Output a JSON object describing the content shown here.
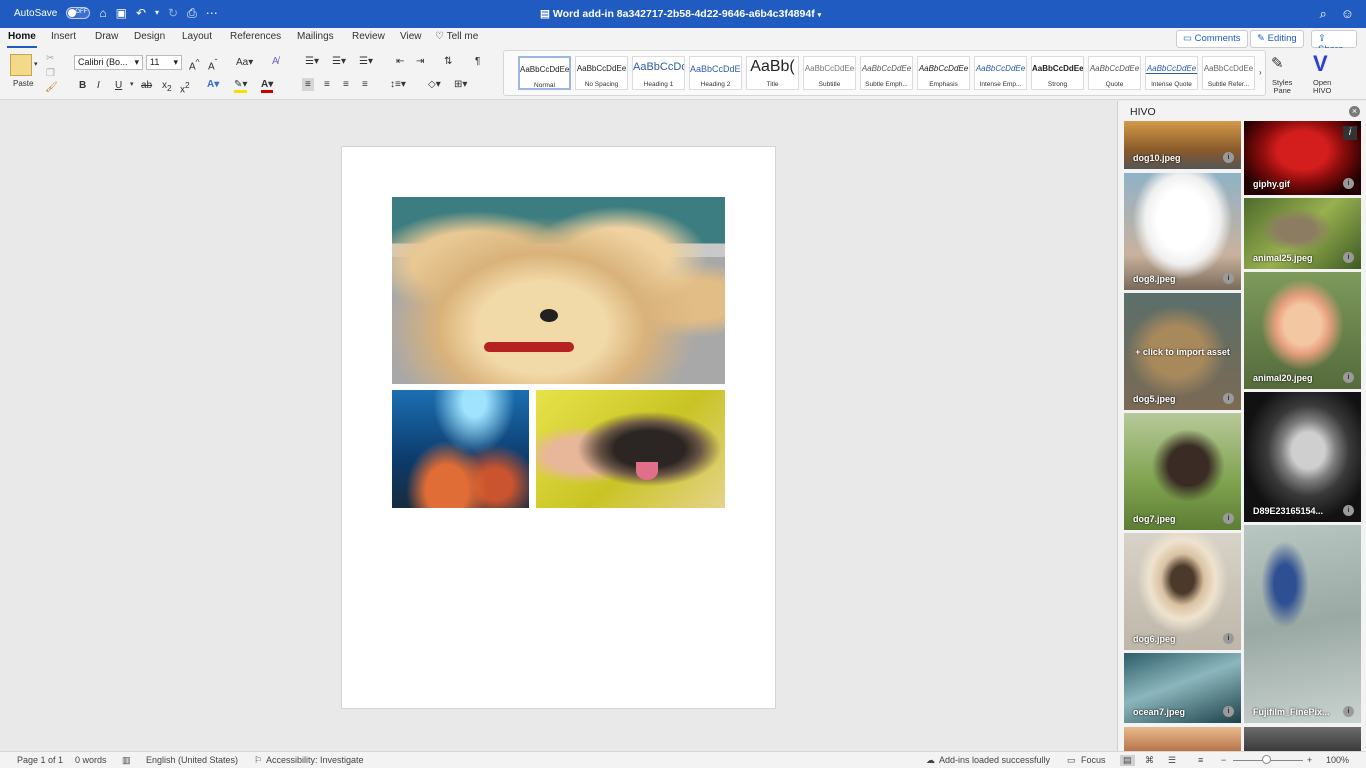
{
  "titlebar": {
    "autosave": "AutoSave",
    "autosave_state": "OFF",
    "doc_title": "Word add-in 8a342717-2b58-4d22-9646-a6b4c3f4894f"
  },
  "tabs": [
    "Home",
    "Insert",
    "Draw",
    "Design",
    "Layout",
    "References",
    "Mailings",
    "Review",
    "View"
  ],
  "tell_me": "Tell me",
  "top_buttons": {
    "comments": "Comments",
    "editing": "Editing",
    "share": "Share"
  },
  "ribbon": {
    "paste": "Paste",
    "font": "Calibri (Bo...",
    "size": "11",
    "styles_pane": [
      "Styles",
      "Pane"
    ],
    "open_hivo": [
      "Open",
      "HIVO"
    ]
  },
  "styles": [
    {
      "sample": "AaBbCcDdEe",
      "name": "Normal"
    },
    {
      "sample": "AaBbCcDdEe",
      "name": "No Spacing"
    },
    {
      "sample": "AaBbCcDc",
      "name": "Heading 1"
    },
    {
      "sample": "AaBbCcDdEe",
      "name": "Heading 2"
    },
    {
      "sample": "AaBb(",
      "name": "Title"
    },
    {
      "sample": "AaBbCcDdEe",
      "name": "Subtitle"
    },
    {
      "sample": "AaBbCcDdEe",
      "name": "Subtle Emph..."
    },
    {
      "sample": "AaBbCcDdEe",
      "name": "Emphasis"
    },
    {
      "sample": "AaBbCcDdEe",
      "name": "Intense Emp..."
    },
    {
      "sample": "AaBbCcDdEe",
      "name": "Strong"
    },
    {
      "sample": "AaBbCcDdEe",
      "name": "Quote"
    },
    {
      "sample": "AaBbCcDdEe",
      "name": "Intense Quote"
    },
    {
      "sample": "AaBbCcDdEe",
      "name": "Subtle Refer..."
    }
  ],
  "panel": {
    "title": "HIVO",
    "import_hint": "+ click to import asset",
    "left": [
      "dog10.jpeg",
      "dog8.jpeg",
      "dog5.jpeg",
      "dog7.jpeg",
      "dog6.jpeg",
      "ocean7.jpeg"
    ],
    "right": [
      "giphy.gif",
      "animal25.jpeg",
      "animal20.jpeg",
      "D89E23165154...",
      "Fujifilm_FinePix..."
    ]
  },
  "status": {
    "page": "Page 1 of 1",
    "words": "0 words",
    "language": "English (United States)",
    "accessibility": "Accessibility: Investigate",
    "addins": "Add-ins loaded successfully",
    "focus": "Focus",
    "zoom": "100%"
  },
  "colors": {
    "brand": "#1f5bc1",
    "ribbon": "#f3f3f3",
    "workspace": "#e9e9e9"
  }
}
